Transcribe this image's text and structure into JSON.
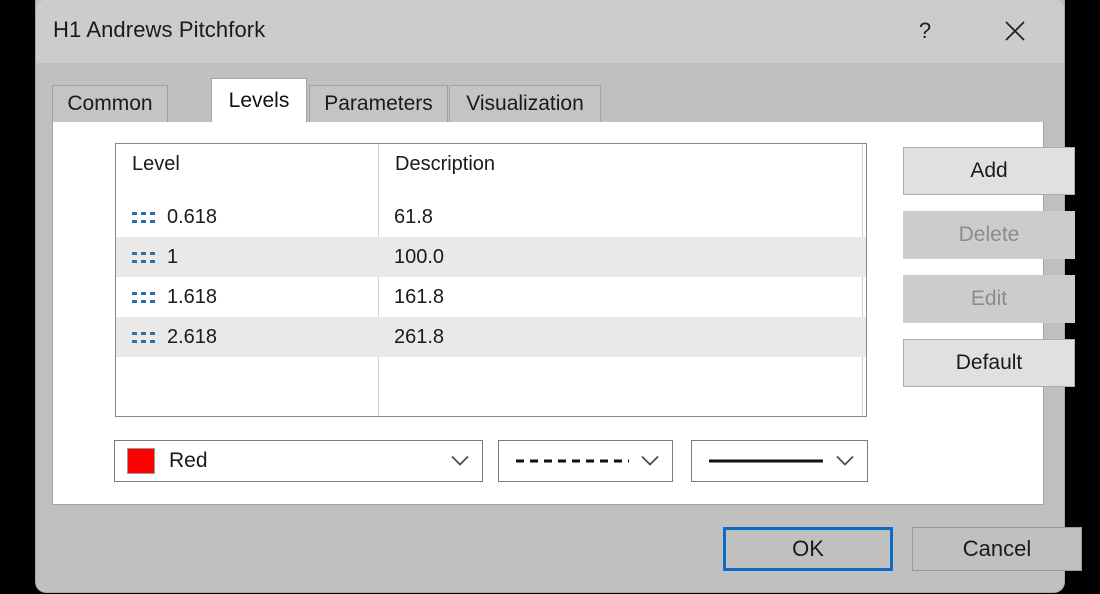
{
  "window": {
    "title": "H1 Andrews Pitchfork",
    "help_icon": "question-mark-icon",
    "close_icon": "close-icon"
  },
  "tabs": [
    {
      "label": "Common",
      "active": false
    },
    {
      "label": "Levels",
      "active": true
    },
    {
      "label": "Parameters",
      "active": false
    },
    {
      "label": "Visualization",
      "active": false
    }
  ],
  "levels_table": {
    "columns": [
      "Level",
      "Description"
    ],
    "rows": [
      {
        "level": "0.618",
        "description": "61.8",
        "icon": "dashed-line-icon"
      },
      {
        "level": "1",
        "description": "100.0",
        "icon": "dashed-line-icon"
      },
      {
        "level": "1.618",
        "description": "161.8",
        "icon": "dashed-line-icon"
      },
      {
        "level": "2.618",
        "description": "261.8",
        "icon": "dashed-line-icon"
      }
    ]
  },
  "side_buttons": [
    {
      "label": "Add",
      "enabled": true
    },
    {
      "label": "Delete",
      "enabled": false
    },
    {
      "label": "Edit",
      "enabled": false
    },
    {
      "label": "Default",
      "enabled": true
    }
  ],
  "style_row": {
    "color": {
      "label": "Red",
      "value": "#ff0000"
    },
    "line_style": {
      "preview": "dashed-line-preview"
    },
    "line_width": {
      "preview": "solid-line-preview"
    }
  },
  "footer": {
    "ok_label": "OK",
    "cancel_label": "Cancel"
  },
  "colors": {
    "accent": "#0a6cc4",
    "dash_icon": "#2a6fa8",
    "dialog_bg": "#c0c0c0",
    "titlebar_bg": "#cccccc",
    "row_alt_bg": "#e9e9e9"
  }
}
